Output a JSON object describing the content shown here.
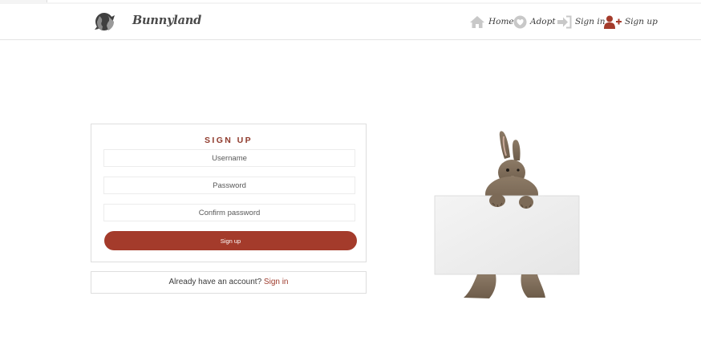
{
  "brand": {
    "name": "Bunnyland"
  },
  "nav": {
    "items": [
      {
        "label": "Home",
        "icon": "home-icon"
      },
      {
        "label": "Adopt",
        "icon": "heart-icon"
      },
      {
        "label": "Sign in",
        "icon": "sign-in-icon"
      },
      {
        "label": "Sign up",
        "icon": "user-plus-icon"
      }
    ]
  },
  "form": {
    "title": "SIGN UP",
    "username_placeholder": "Username",
    "password_placeholder": "Password",
    "confirm_placeholder": "Confirm password",
    "submit_label": "Sign up"
  },
  "signin_prompt": {
    "text": "Already have an account? ",
    "link": "Sign in"
  },
  "colors": {
    "accent": "#a43b2b",
    "title": "#8f3a2c",
    "nav_icon": "#c8c8c8",
    "sign_up_icon": "#a43b2b"
  },
  "image": {
    "subject": "bunny-holding-blank-sign"
  }
}
